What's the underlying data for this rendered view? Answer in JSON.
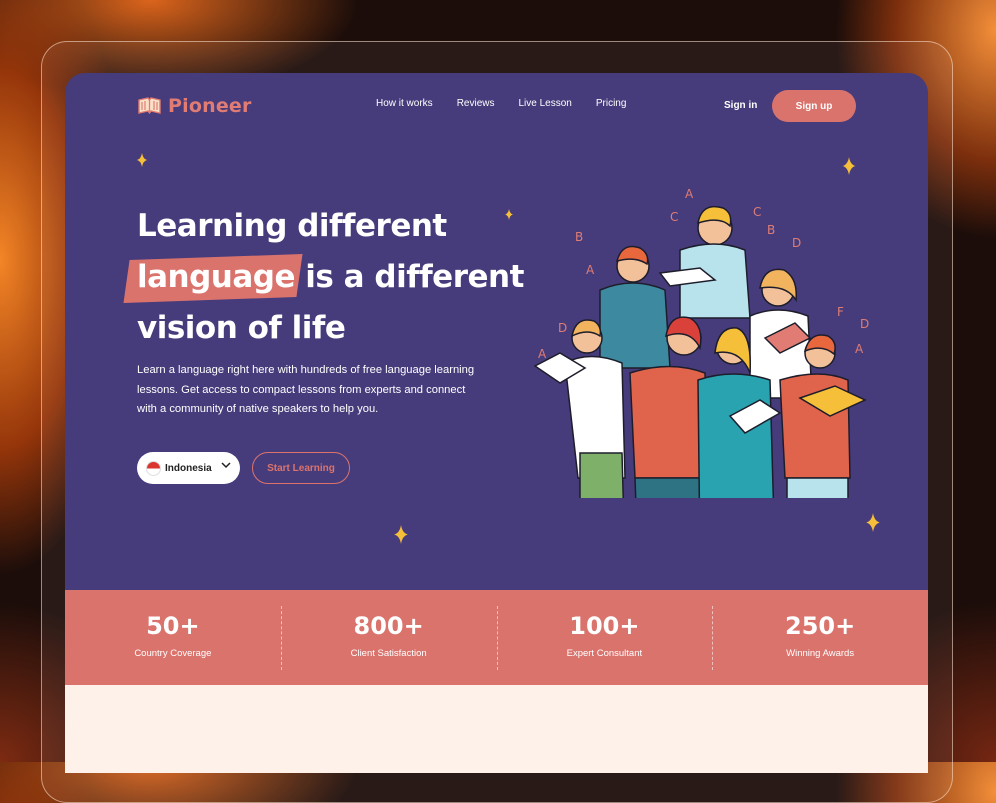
{
  "brand": {
    "name": "Pioneer",
    "logo_icon": "book-icon",
    "accent_color": "#db736d",
    "bg_color": "#463c7b"
  },
  "nav": {
    "links": [
      "How it works",
      "Reviews",
      "Live Lesson",
      "Pricing"
    ],
    "signin": "Sign in",
    "signup": "Sign up"
  },
  "hero": {
    "title_line1": "Learning different",
    "title_highlight": "language",
    "title_line2_rest": " is a different",
    "title_line3": "vision of life",
    "description": "Learn a language right here with hundreds of free language learning lessons. Get access to compact lessons from experts and connect with a community of native speakers to help you.",
    "language_select": "Indonesia",
    "cta": "Start Learning",
    "illustration": "group-reading-books-illustration"
  },
  "stats": [
    {
      "value": "50+",
      "label": "Country Coverage"
    },
    {
      "value": "800+",
      "label": "Client Satisfaction"
    },
    {
      "value": "100+",
      "label": "Expert Consultant"
    },
    {
      "value": "250+",
      "label": "Winning Awards"
    }
  ]
}
